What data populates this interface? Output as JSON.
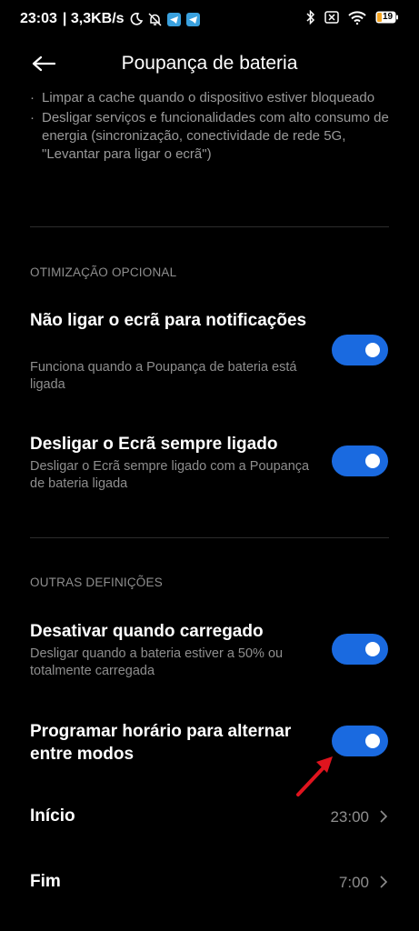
{
  "status_bar": {
    "time": "23:03",
    "speed": "| 3,3KB/s",
    "battery_level": "19",
    "icons_left": [
      "moon-icon",
      "bell-off-icon",
      "telegram-icon",
      "telegram-icon"
    ],
    "icons_right": [
      "bluetooth-icon",
      "no-sim-icon",
      "wifi-icon",
      "battery-icon"
    ]
  },
  "header": {
    "title": "Poupança de bateria"
  },
  "bullets": [
    "Limpar a cache quando o dispositivo estiver bloqueado",
    "Desligar serviços e funcionalidades com alto consumo de energia (sincronização, conectividade de rede 5G, \"Levantar para ligar o ecrã\")"
  ],
  "sections": {
    "optional": {
      "header": "OTIMIZAÇÃO OPCIONAL",
      "rows": [
        {
          "title": "Não ligar o ecrã para notificações",
          "subtitle": "Funciona quando a Poupança de bateria está ligada",
          "enabled": true
        },
        {
          "title": "Desligar o Ecrã sempre ligado",
          "subtitle": "Desligar o Ecrã sempre ligado com a Poupança de bateria ligada",
          "enabled": true
        }
      ]
    },
    "other": {
      "header": "OUTRAS DEFINIÇÕES",
      "rows": [
        {
          "title": "Desativar quando carregado",
          "subtitle": "Desligar quando a bateria estiver a 50% ou totalmente carregada",
          "enabled": true
        },
        {
          "title": "Programar horário para alternar entre modos",
          "enabled": true
        }
      ]
    }
  },
  "schedule": {
    "start_label": "Início",
    "start_value": "23:00",
    "end_label": "Fim",
    "end_value": "7:00"
  },
  "colors": {
    "background": "#000000",
    "accent": "#1a6ae0",
    "secondary_text": "#8e8e8e",
    "annotation_arrow": "#e0141e"
  }
}
